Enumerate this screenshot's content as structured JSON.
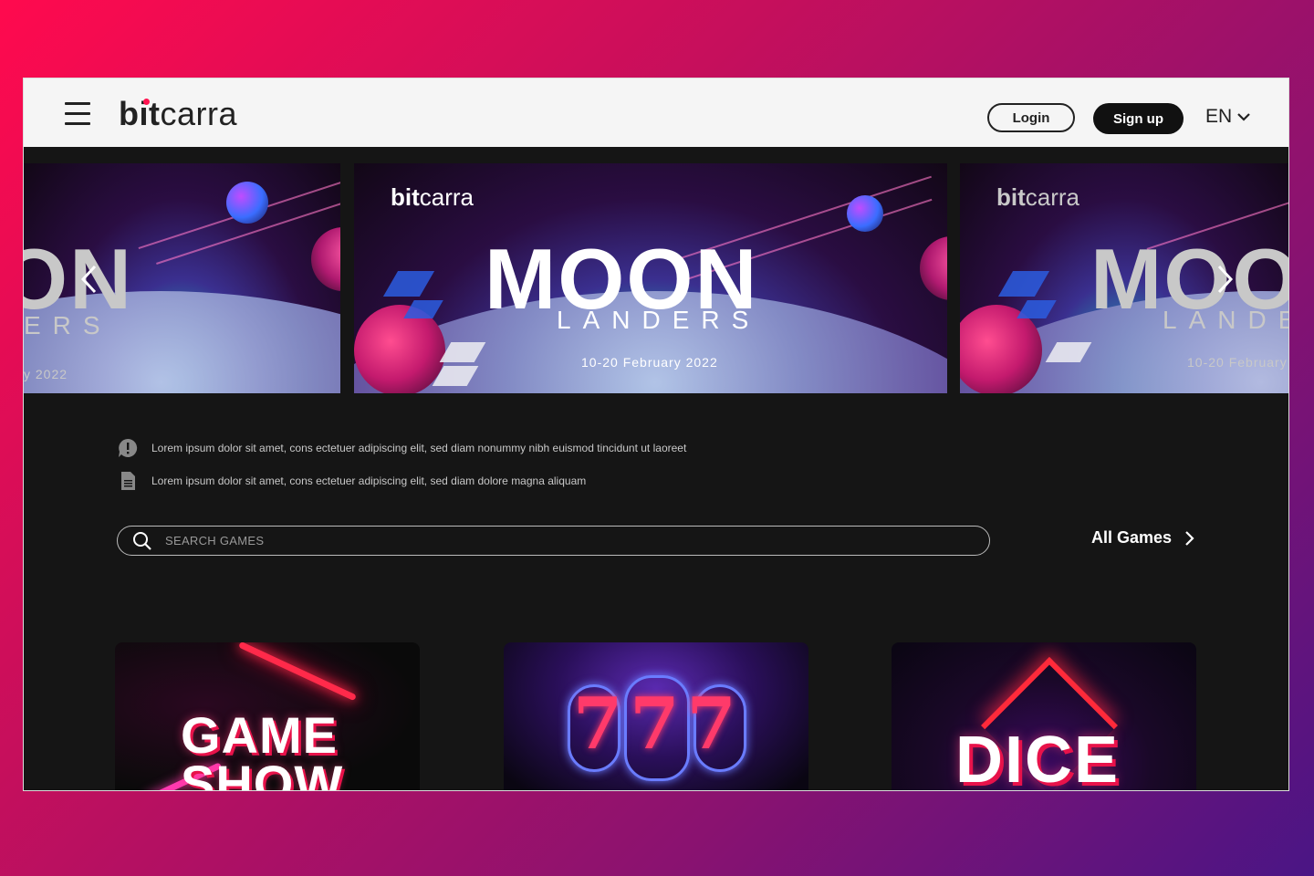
{
  "header": {
    "logo_bit": "bit",
    "logo_carra": "carra",
    "login_label": "Login",
    "signup_label": "Sign up",
    "language": "EN"
  },
  "banners": {
    "logo_bit": "bit",
    "logo_carra": "carra",
    "title": "MOON",
    "subtitle": "LANDERS",
    "dates": "10-20 February 2022",
    "left_title": "ON",
    "left_subtitle": "ERS",
    "left_dates": "y 2022",
    "right_title": "MOO",
    "right_subtitle": "LANDE",
    "right_dates": "10-20 February"
  },
  "notices": [
    {
      "icon": "alert-bubble-icon",
      "text": "Lorem ipsum dolor sit amet, cons ectetuer adipiscing elit, sed diam nonummy nibh euismod tincidunt ut laoreet"
    },
    {
      "icon": "document-icon",
      "text": "Lorem ipsum dolor sit amet, cons ectetuer adipiscing elit, sed diam dolore magna aliquam"
    }
  ],
  "search": {
    "placeholder": "SEARCH GAMES"
  },
  "all_games_label": "All Games",
  "games": [
    {
      "name": "game-show",
      "line1": "GAME",
      "line2": "SHOW"
    },
    {
      "name": "slots",
      "text": "777"
    },
    {
      "name": "dice",
      "text": "DICE"
    }
  ],
  "colors": {
    "accent": "#ff1450",
    "background": "#151515",
    "header_bg": "#f5f5f5"
  }
}
